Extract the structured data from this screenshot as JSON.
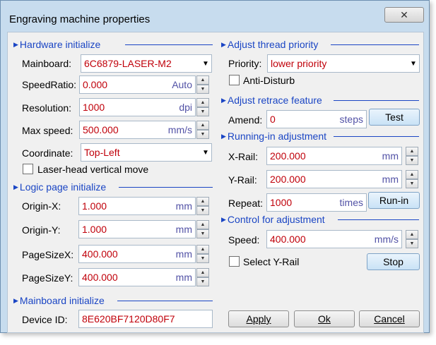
{
  "window": {
    "title": "Engraving machine properties",
    "close_label": "✕"
  },
  "hardware": {
    "title": "Hardware initialize",
    "mainboard": {
      "label": "Mainboard:",
      "value": "6C6879-LASER-M2"
    },
    "speed_ratio": {
      "label": "SpeedRatio:",
      "value": "0.000",
      "unit": "Auto"
    },
    "resolution": {
      "label": "Resolution:",
      "value": "1000",
      "unit": "dpi"
    },
    "max_speed": {
      "label": "Max speed:",
      "value": "500.000",
      "unit": "mm/s"
    },
    "coordinate": {
      "label": "Coordinate:",
      "value": "Top-Left"
    },
    "vertical_move": {
      "label": "Laser-head vertical move",
      "checked": false
    }
  },
  "logic_page": {
    "title": "Logic page initialize",
    "origin_x": {
      "label": "Origin-X:",
      "value": "1.000",
      "unit": "mm"
    },
    "origin_y": {
      "label": "Origin-Y:",
      "value": "1.000",
      "unit": "mm"
    },
    "page_size_x": {
      "label": "PageSizeX:",
      "value": "400.000",
      "unit": "mm"
    },
    "page_size_y": {
      "label": "PageSizeY:",
      "value": "400.000",
      "unit": "mm"
    }
  },
  "mainboard_init": {
    "title": "Mainboard initialize",
    "device_id": {
      "label": "Device ID:",
      "value": "8E620BF7120D80F7"
    }
  },
  "thread_priority": {
    "title": "Adjust thread priority",
    "priority": {
      "label": "Priority:",
      "value": "lower priority"
    },
    "anti_disturb": {
      "label": "Anti-Disturb",
      "checked": false
    }
  },
  "retrace": {
    "title": "Adjust retrace feature",
    "amend": {
      "label": "Amend:",
      "value": "0",
      "unit": "steps"
    },
    "test_label": "Test"
  },
  "running_in": {
    "title": "Running-in adjustment",
    "x_rail": {
      "label": "X-Rail:",
      "value": "200.000",
      "unit": "mm"
    },
    "y_rail": {
      "label": "Y-Rail:",
      "value": "200.000",
      "unit": "mm"
    },
    "repeat": {
      "label": "Repeat:",
      "value": "1000",
      "unit": "times"
    },
    "run_in_label": "Run-in"
  },
  "control": {
    "title": "Control for adjustment",
    "speed": {
      "label": "Speed:",
      "value": "400.000",
      "unit": "mm/s"
    },
    "select_y_rail": {
      "label": "Select Y-Rail",
      "checked": false
    },
    "stop_label": "Stop"
  },
  "footer": {
    "apply_label": "Apply",
    "ok_label": "Ok",
    "cancel_label": "Cancel"
  },
  "colors": {
    "group_title": "#1a45c4",
    "value_text": "#c0000a",
    "unit_text": "#5252a6",
    "window_frame": "#c7dcee"
  }
}
